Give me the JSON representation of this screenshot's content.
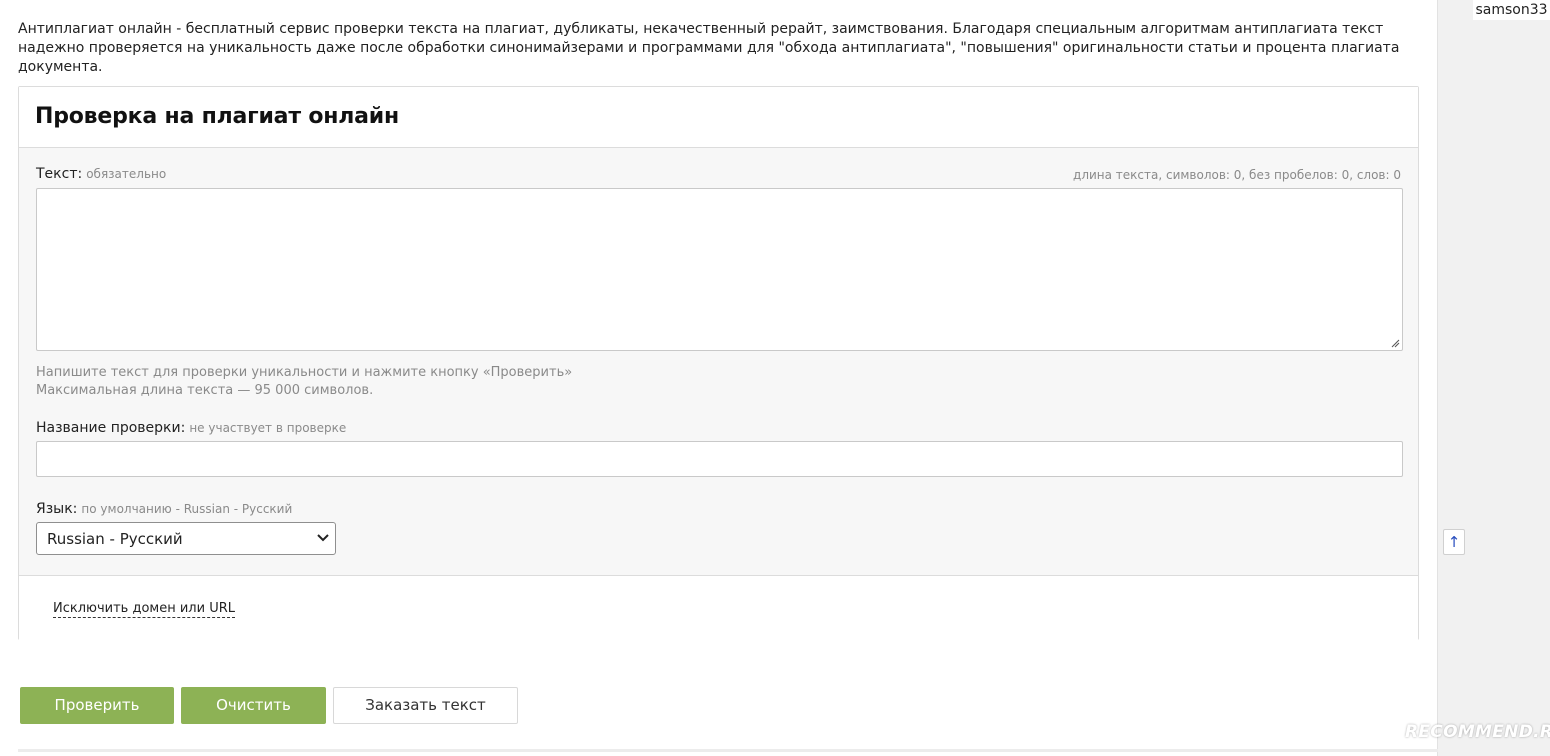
{
  "intro": "Антиплагиат онлайн - бесплатный сервис проверки текста на плагиат, дубликаты, некачественный рерайт, заимствования. Благодаря специальным алгоритмам антиплагиата текст надежно проверяется на уникальность даже после обработки синонимайзерами и программами для \"обхода антиплагиата\", \"повышения\" оригинальности статьи и процента плагиата документа.",
  "card": {
    "title": "Проверка на плагиат онлайн",
    "text_label": "Текст:",
    "text_hint": "обязательно",
    "counter": "длина текста, символов: 0, без пробелов: 0, слов: 0",
    "textarea_value": "",
    "help_line1": "Напишите текст для проверки уникальности и нажмите кнопку «Проверить»",
    "help_line2": "Максимальная длина текста — 95 000 символов.",
    "name_label": "Название проверки:",
    "name_hint": "не участвует в проверке",
    "name_value": "",
    "lang_label": "Язык:",
    "lang_hint": "по умолчанию - Russian - Русский",
    "lang_selected": "Russian - Русский",
    "exclude_link": "Исключить домен или URL"
  },
  "buttons": {
    "check": "Проверить",
    "clear": "Очистить",
    "order": "Заказать текст"
  },
  "sidebar": {
    "username": "samson33",
    "up_arrow": "↑"
  },
  "watermark": "RECOMMEND.RU",
  "colors": {
    "accent_green": "#8db255",
    "panel_bg": "#f7f7f7",
    "hint_gray": "#8a8a8a"
  }
}
